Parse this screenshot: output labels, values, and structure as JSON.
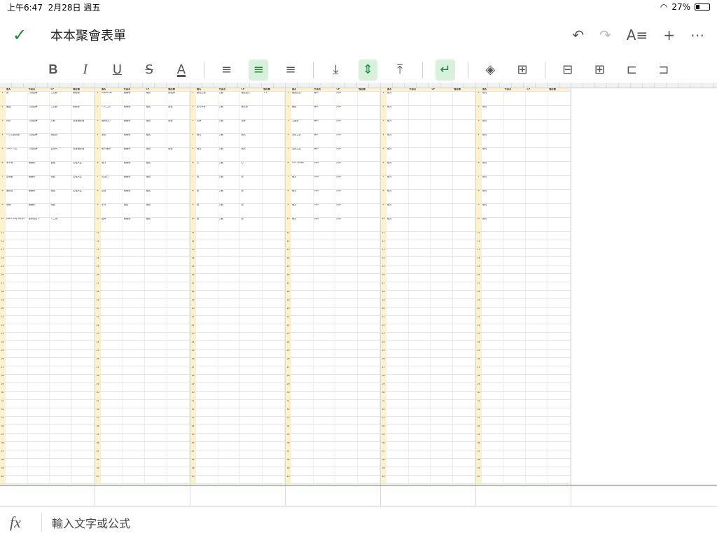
{
  "status": {
    "time": "上午6:47",
    "date": "2月28日 週五",
    "battery": "27%"
  },
  "header": {
    "title": "本本聚會表單"
  },
  "formula_bar": {
    "placeholder": "輸入文字或公式"
  },
  "sheet": {
    "header_labels": [
      "書名",
      "作品名",
      "CP",
      "備註欄"
    ],
    "blocks": [
      {
        "rows": [
          [
            "晨",
            "刀劍亂舞",
            "三日鶴",
            "鶴純鶴"
          ],
          [
            "極盛",
            "刀劍亂舞",
            "三日鶴",
            "鶴純鶴"
          ],
          [
            "拼拼",
            "刀劍亂舞",
            "刀鶴",
            "長曾彌虎徹"
          ],
          [
            "ヘし切長谷部",
            "刀劍亂舞",
            "燭長谷",
            ""
          ],
          [
            "108アリ王",
            "刀劍亂舞",
            "日讀司",
            "長曾彌虎徹"
          ],
          [
            "未不等",
            "極機制",
            "宮燭",
            "正義大正"
          ],
          [
            "空隙動",
            "極機制",
            "燭長",
            "正義大正"
          ],
          [
            "蜜柑紋",
            "極機制",
            "燭長",
            "正義大正"
          ],
          [
            "彩機",
            "極機制",
            "燭長",
            ""
          ],
          [
            "Don't Say Sorry!",
            "進擊的巨人",
            "一二萬",
            ""
          ]
        ]
      },
      {
        "rows": [
          [
            "Super Jail",
            "極機制",
            "燭長",
            "燭長陣"
          ],
          [
            "一人二天",
            "極機制",
            "燭長",
            "燭長"
          ],
          [
            "燭刻的力",
            "極機制",
            "燭長",
            "燭長"
          ],
          [
            "凜風",
            "極機制",
            "燭長",
            ""
          ],
          [
            "黑人雛菊",
            "極機制",
            "燭長",
            "燭長"
          ],
          [
            "旅行",
            "極機制",
            "燭長",
            ""
          ],
          [
            "花在心",
            "極機制",
            "燭長",
            ""
          ],
          [
            "空焰",
            "極機制",
            "燭長",
            ""
          ],
          [
            "冬冷",
            "燭長",
            "燭長",
            ""
          ],
          [
            "夏時",
            "極機制",
            "燭長",
            ""
          ]
        ]
      },
      {
        "rows": [
          [
            "極北之夜",
            "刀鶴",
            "極北君子",
            "1-1"
          ],
          [
            "北門草莓",
            "刀鶴",
            "極北夜",
            ""
          ],
          [
            "花嫁",
            "刀鶴",
            "花嫁",
            ""
          ],
          [
            "燭光",
            "刀鶴",
            "燭光",
            ""
          ],
          [
            "燭光",
            "刀鶴",
            "燭光",
            ""
          ],
          [
            "心",
            "刀鶴",
            "心",
            ""
          ],
          [
            "晨",
            "刀鶴",
            "晨",
            ""
          ],
          [
            "晨",
            "刀鶴",
            "晨",
            ""
          ],
          [
            "晨",
            "刀鶴",
            "晨",
            ""
          ],
          [
            "晨",
            "刀鶴",
            "晨",
            ""
          ]
        ]
      },
      {
        "rows": [
          [
            "極亂的日",
            "職人",
            "JUJU",
            ""
          ],
          [
            "極亂",
            "職人",
            "JUJU",
            ""
          ],
          [
            "上燈影",
            "職人",
            "JUJU",
            ""
          ],
          [
            "光的之空",
            "職人",
            "JUJU",
            ""
          ],
          [
            "九成之空",
            "職人",
            "JUJU",
            ""
          ],
          [
            "Crit Center",
            "JUJU",
            "JUJU",
            ""
          ],
          [
            "燭光",
            "JUJU",
            "JUJU",
            ""
          ],
          [
            "燭光",
            "JUJU",
            "JUJU",
            ""
          ],
          [
            "燭光",
            "JUJU",
            "JUJU",
            ""
          ],
          [
            "燭光",
            "JUJU",
            "JUJU",
            ""
          ]
        ]
      },
      {
        "rows": [
          [
            "燭光",
            "",
            "",
            ""
          ],
          [
            "燭光",
            "",
            "",
            ""
          ],
          [
            "燭光",
            "",
            "",
            ""
          ],
          [
            "燭光",
            "",
            "",
            ""
          ],
          [
            "燭光",
            "",
            "",
            ""
          ],
          [
            "燭光",
            "",
            "",
            ""
          ],
          [
            "燭光",
            "",
            "",
            ""
          ],
          [
            "燭光",
            "",
            "",
            ""
          ],
          [
            "燭光",
            "",
            "",
            ""
          ],
          [
            "燭光",
            "",
            "",
            ""
          ]
        ]
      },
      {
        "rows": [
          [
            "燭光",
            "",
            "",
            ""
          ],
          [
            "燭光",
            "",
            "",
            ""
          ],
          [
            "燭光",
            "",
            "",
            ""
          ],
          [
            "燭光",
            "",
            "",
            ""
          ],
          [
            "燭光",
            "",
            "",
            ""
          ],
          [
            "燭光",
            "",
            "",
            ""
          ],
          [
            "燭光",
            "",
            "",
            ""
          ],
          [
            "燭光",
            "",
            "",
            ""
          ],
          [
            "燭光",
            "",
            "",
            ""
          ],
          [
            "燭光",
            "",
            "",
            ""
          ]
        ]
      }
    ]
  }
}
